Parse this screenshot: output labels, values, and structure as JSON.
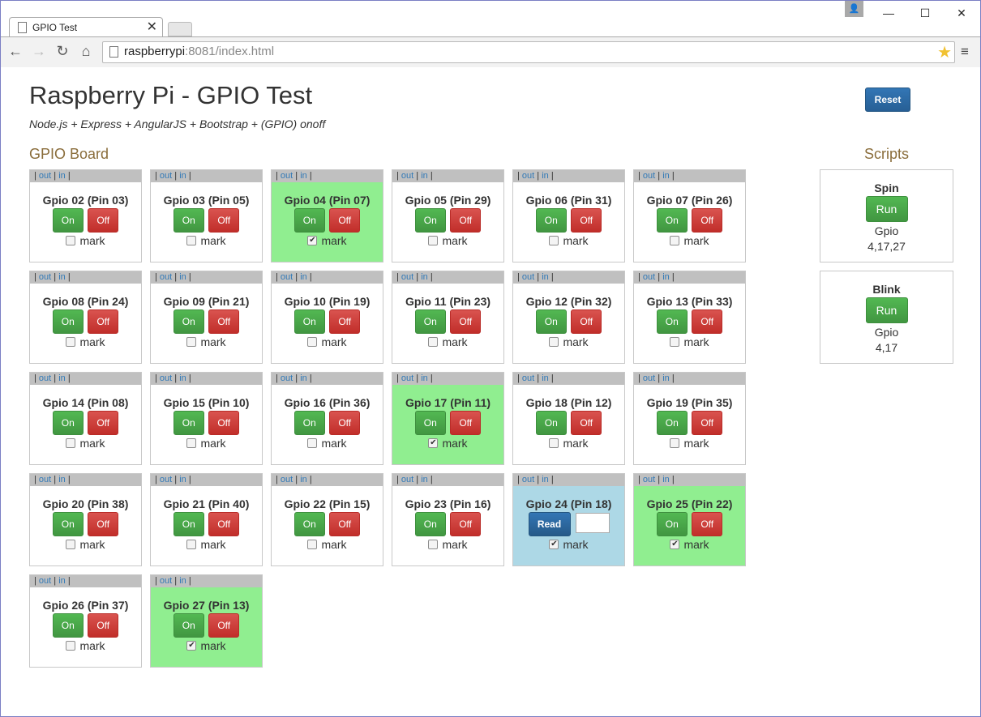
{
  "browser": {
    "tab_title": "GPIO Test",
    "tab_close": "✕",
    "url_host": "raspberrypi",
    "url_rest": ":8081/index.html",
    "user_icon": "👤",
    "minimize": "—",
    "maximize": "☐",
    "close": "✕",
    "back": "←",
    "forward": "→",
    "reload": "↻",
    "home": "⌂",
    "star": "★",
    "menu": "≡"
  },
  "page": {
    "title": "Raspberry Pi - GPIO Test",
    "subtitle": "Node.js + Express + AngularJS + Bootstrap + (GPIO) onoff",
    "reset_label": "Reset",
    "board_title": "GPIO Board",
    "scripts_title": "Scripts",
    "card_head": {
      "sep": "|",
      "out": "out",
      "in": "in"
    },
    "on_label": "On",
    "off_label": "Off",
    "read_label": "Read",
    "mark_label": "mark"
  },
  "gpios": [
    {
      "label": "Gpio 02 (Pin 03)",
      "state": "normal",
      "mark": false
    },
    {
      "label": "Gpio 03 (Pin 05)",
      "state": "normal",
      "mark": false
    },
    {
      "label": "Gpio 04 (Pin 07)",
      "state": "on",
      "mark": true
    },
    {
      "label": "Gpio 05 (Pin 29)",
      "state": "normal",
      "mark": false
    },
    {
      "label": "Gpio 06 (Pin 31)",
      "state": "normal",
      "mark": false
    },
    {
      "label": "Gpio 07 (Pin 26)",
      "state": "normal",
      "mark": false
    },
    {
      "label": "Gpio 08 (Pin 24)",
      "state": "normal",
      "mark": false
    },
    {
      "label": "Gpio 09 (Pin 21)",
      "state": "normal",
      "mark": false
    },
    {
      "label": "Gpio 10 (Pin 19)",
      "state": "normal",
      "mark": false
    },
    {
      "label": "Gpio 11 (Pin 23)",
      "state": "normal",
      "mark": false
    },
    {
      "label": "Gpio 12 (Pin 32)",
      "state": "normal",
      "mark": false
    },
    {
      "label": "Gpio 13 (Pin 33)",
      "state": "normal",
      "mark": false
    },
    {
      "label": "Gpio 14 (Pin 08)",
      "state": "normal",
      "mark": false
    },
    {
      "label": "Gpio 15 (Pin 10)",
      "state": "normal",
      "mark": false
    },
    {
      "label": "Gpio 16 (Pin 36)",
      "state": "normal",
      "mark": false
    },
    {
      "label": "Gpio 17 (Pin 11)",
      "state": "on",
      "mark": true
    },
    {
      "label": "Gpio 18 (Pin 12)",
      "state": "normal",
      "mark": false
    },
    {
      "label": "Gpio 19 (Pin 35)",
      "state": "normal",
      "mark": false
    },
    {
      "label": "Gpio 20 (Pin 38)",
      "state": "normal",
      "mark": false
    },
    {
      "label": "Gpio 21 (Pin 40)",
      "state": "normal",
      "mark": false
    },
    {
      "label": "Gpio 22 (Pin 15)",
      "state": "normal",
      "mark": false
    },
    {
      "label": "Gpio 23 (Pin 16)",
      "state": "normal",
      "mark": false
    },
    {
      "label": "Gpio 24 (Pin 18)",
      "state": "input",
      "mark": true
    },
    {
      "label": "Gpio 25 (Pin 22)",
      "state": "on",
      "mark": true
    },
    {
      "label": "Gpio 26 (Pin 37)",
      "state": "normal",
      "mark": false
    },
    {
      "label": "Gpio 27 (Pin 13)",
      "state": "on",
      "mark": true
    }
  ],
  "scripts": [
    {
      "name": "Spin",
      "run_label": "Run",
      "gpio_label": "Gpio",
      "pins": "4,17,27"
    },
    {
      "name": "Blink",
      "run_label": "Run",
      "gpio_label": "Gpio",
      "pins": "4,17"
    }
  ],
  "colors": {
    "on_bg": "#90ee90",
    "input_bg": "#add8e6",
    "heading_brown": "#8a6d3b",
    "btn_green": "#419641",
    "btn_red": "#c12e2a",
    "btn_blue": "#265a88"
  }
}
